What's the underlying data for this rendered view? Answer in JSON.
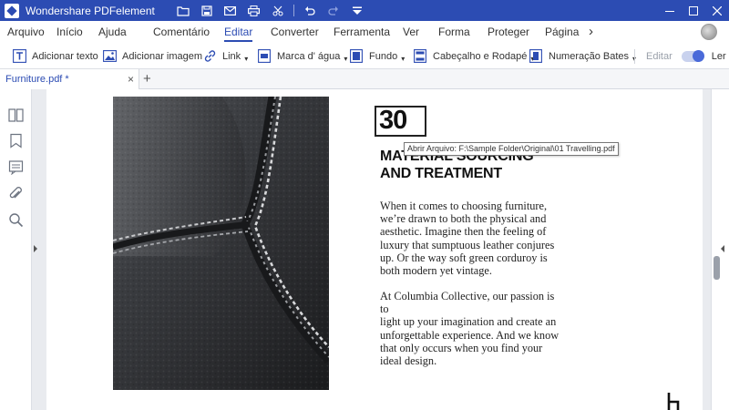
{
  "app": {
    "title": "Wondershare PDFelement"
  },
  "menu": {
    "items": [
      "Arquivo",
      "Início",
      "Ajuda",
      "Comentário",
      "Editar",
      "Converter",
      "Ferramenta",
      "Ver",
      "Forma",
      "Proteger",
      "Página"
    ],
    "active": "Editar",
    "more": "›"
  },
  "toolbar": {
    "add_text": "Adicionar texto",
    "add_image": "Adicionar imagem",
    "link": "Link",
    "watermark": "Marca d' água",
    "background": "Fundo",
    "header_footer": "Cabeçalho e Rodapé",
    "bates": "Numeração Bates",
    "edit_label": "Editar",
    "read_label": "Ler",
    "caret": "▾"
  },
  "tabs": {
    "document": "Furniture.pdf *",
    "close": "×",
    "add": "+"
  },
  "document": {
    "number": "30",
    "heading_line1": "MATERIAL SOURCING",
    "heading_line2": "AND TREATMENT",
    "tooltip": "Abrir Arquivo: F:\\Sample Folder\\Original\\01 Travelling.pdf",
    "paragraph1": [
      "When it comes to choosing furniture,",
      "we’re drawn to both the physical and",
      "aesthetic. Imagine then the feeling of",
      "luxury that sumptuous leather conjures",
      "up. Or the way soft green corduroy is",
      "both modern yet vintage."
    ],
    "paragraph2": [
      "At Columbia Collective, our passion is to",
      "light up your imagination and create an",
      "unforgettable experience. And we know",
      "that only occurs when you find your",
      "ideal design."
    ]
  },
  "colors": {
    "accent": "#2c4cb3",
    "title_bar": "#2c4cb3",
    "toggle": "#4a6ad9"
  }
}
